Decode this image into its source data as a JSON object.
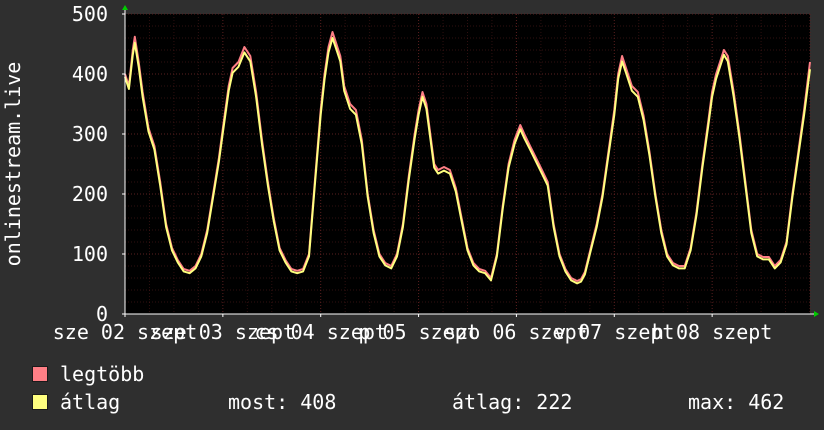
{
  "chart_data": {
    "type": "line",
    "ylabel": "onlinestream.live",
    "ylim": [
      0,
      500
    ],
    "yticks": [
      0,
      100,
      200,
      300,
      400,
      500
    ],
    "x_tick_labels": [
      "sze 02 szept",
      "sze 03 szept",
      "cs 04 szept",
      "p 05 szept",
      "szo 06 szept",
      "v 07 szept",
      "h 08 szept"
    ],
    "grid": true,
    "colors": {
      "max": "#ff7f86",
      "avg": "#ffff7f",
      "background": "#2f2f2f",
      "plot": "#000000",
      "grid": "#5a1f1f",
      "axis": "#ffffff",
      "arrow": "#00cc00"
    },
    "series": [
      {
        "name": "legtöbb",
        "key": "max",
        "points": [
          [
            0,
            400
          ],
          [
            0.04,
            380
          ],
          [
            0.08,
            440
          ],
          [
            0.1,
            462
          ],
          [
            0.14,
            420
          ],
          [
            0.18,
            370
          ],
          [
            0.24,
            310
          ],
          [
            0.3,
            280
          ],
          [
            0.36,
            220
          ],
          [
            0.42,
            150
          ],
          [
            0.48,
            110
          ],
          [
            0.54,
            90
          ],
          [
            0.6,
            75
          ],
          [
            0.66,
            72
          ],
          [
            0.72,
            80
          ],
          [
            0.78,
            100
          ],
          [
            0.84,
            140
          ],
          [
            0.9,
            200
          ],
          [
            0.96,
            260
          ],
          [
            1.0,
            310
          ],
          [
            1.06,
            380
          ],
          [
            1.1,
            410
          ],
          [
            1.16,
            420
          ],
          [
            1.22,
            445
          ],
          [
            1.28,
            430
          ],
          [
            1.34,
            370
          ],
          [
            1.4,
            290
          ],
          [
            1.46,
            220
          ],
          [
            1.52,
            160
          ],
          [
            1.58,
            110
          ],
          [
            1.64,
            90
          ],
          [
            1.7,
            75
          ],
          [
            1.76,
            72
          ],
          [
            1.82,
            75
          ],
          [
            1.88,
            100
          ],
          [
            1.94,
            220
          ],
          [
            2.0,
            340
          ],
          [
            2.04,
            400
          ],
          [
            2.08,
            445
          ],
          [
            2.12,
            470
          ],
          [
            2.16,
            450
          ],
          [
            2.2,
            430
          ],
          [
            2.24,
            380
          ],
          [
            2.3,
            350
          ],
          [
            2.36,
            340
          ],
          [
            2.42,
            290
          ],
          [
            2.48,
            200
          ],
          [
            2.54,
            140
          ],
          [
            2.6,
            100
          ],
          [
            2.66,
            85
          ],
          [
            2.72,
            80
          ],
          [
            2.78,
            100
          ],
          [
            2.84,
            150
          ],
          [
            2.9,
            230
          ],
          [
            2.96,
            300
          ],
          [
            3.0,
            340
          ],
          [
            3.04,
            370
          ],
          [
            3.08,
            350
          ],
          [
            3.12,
            300
          ],
          [
            3.16,
            250
          ],
          [
            3.2,
            240
          ],
          [
            3.26,
            245
          ],
          [
            3.32,
            240
          ],
          [
            3.38,
            210
          ],
          [
            3.44,
            160
          ],
          [
            3.5,
            110
          ],
          [
            3.56,
            85
          ],
          [
            3.62,
            75
          ],
          [
            3.68,
            72
          ],
          [
            3.74,
            60
          ],
          [
            3.8,
            100
          ],
          [
            3.86,
            180
          ],
          [
            3.92,
            250
          ],
          [
            3.98,
            290
          ],
          [
            4.04,
            315
          ],
          [
            4.08,
            300
          ],
          [
            4.14,
            280
          ],
          [
            4.2,
            260
          ],
          [
            4.26,
            240
          ],
          [
            4.32,
            220
          ],
          [
            4.38,
            150
          ],
          [
            4.44,
            100
          ],
          [
            4.5,
            75
          ],
          [
            4.56,
            60
          ],
          [
            4.62,
            55
          ],
          [
            4.66,
            58
          ],
          [
            4.7,
            70
          ],
          [
            4.76,
            110
          ],
          [
            4.82,
            150
          ],
          [
            4.88,
            200
          ],
          [
            4.94,
            270
          ],
          [
            5.0,
            340
          ],
          [
            5.04,
            400
          ],
          [
            5.08,
            430
          ],
          [
            5.12,
            410
          ],
          [
            5.18,
            380
          ],
          [
            5.24,
            370
          ],
          [
            5.3,
            330
          ],
          [
            5.36,
            270
          ],
          [
            5.42,
            200
          ],
          [
            5.48,
            140
          ],
          [
            5.54,
            100
          ],
          [
            5.6,
            85
          ],
          [
            5.66,
            80
          ],
          [
            5.72,
            80
          ],
          [
            5.78,
            110
          ],
          [
            5.84,
            170
          ],
          [
            5.9,
            250
          ],
          [
            5.96,
            320
          ],
          [
            6.0,
            370
          ],
          [
            6.04,
            400
          ],
          [
            6.08,
            420
          ],
          [
            6.12,
            440
          ],
          [
            6.16,
            430
          ],
          [
            6.22,
            370
          ],
          [
            6.28,
            300
          ],
          [
            6.34,
            220
          ],
          [
            6.4,
            140
          ],
          [
            6.46,
            100
          ],
          [
            6.52,
            95
          ],
          [
            6.58,
            95
          ],
          [
            6.64,
            80
          ],
          [
            6.7,
            90
          ],
          [
            6.76,
            120
          ],
          [
            6.82,
            200
          ],
          [
            6.88,
            270
          ],
          [
            6.94,
            340
          ],
          [
            7.0,
            420
          ]
        ]
      },
      {
        "name": "átlag",
        "key": "avg",
        "points": [
          [
            0,
            395
          ],
          [
            0.04,
            375
          ],
          [
            0.08,
            432
          ],
          [
            0.1,
            452
          ],
          [
            0.14,
            412
          ],
          [
            0.18,
            362
          ],
          [
            0.24,
            304
          ],
          [
            0.3,
            274
          ],
          [
            0.36,
            214
          ],
          [
            0.42,
            145
          ],
          [
            0.48,
            106
          ],
          [
            0.54,
            86
          ],
          [
            0.6,
            71
          ],
          [
            0.66,
            68
          ],
          [
            0.72,
            76
          ],
          [
            0.78,
            96
          ],
          [
            0.84,
            135
          ],
          [
            0.9,
            195
          ],
          [
            0.96,
            254
          ],
          [
            1.0,
            303
          ],
          [
            1.06,
            372
          ],
          [
            1.1,
            402
          ],
          [
            1.16,
            412
          ],
          [
            1.22,
            436
          ],
          [
            1.28,
            421
          ],
          [
            1.34,
            362
          ],
          [
            1.4,
            283
          ],
          [
            1.46,
            214
          ],
          [
            1.52,
            155
          ],
          [
            1.58,
            106
          ],
          [
            1.64,
            86
          ],
          [
            1.7,
            71
          ],
          [
            1.76,
            68
          ],
          [
            1.82,
            71
          ],
          [
            1.88,
            96
          ],
          [
            1.94,
            214
          ],
          [
            2.0,
            332
          ],
          [
            2.04,
            392
          ],
          [
            2.08,
            436
          ],
          [
            2.12,
            460
          ],
          [
            2.16,
            441
          ],
          [
            2.2,
            421
          ],
          [
            2.24,
            372
          ],
          [
            2.3,
            342
          ],
          [
            2.36,
            332
          ],
          [
            2.42,
            283
          ],
          [
            2.48,
            195
          ],
          [
            2.54,
            135
          ],
          [
            2.6,
            96
          ],
          [
            2.66,
            81
          ],
          [
            2.72,
            76
          ],
          [
            2.78,
            96
          ],
          [
            2.84,
            145
          ],
          [
            2.9,
            224
          ],
          [
            2.96,
            293
          ],
          [
            3.0,
            332
          ],
          [
            3.04,
            362
          ],
          [
            3.08,
            342
          ],
          [
            3.12,
            293
          ],
          [
            3.16,
            244
          ],
          [
            3.2,
            234
          ],
          [
            3.26,
            239
          ],
          [
            3.32,
            234
          ],
          [
            3.38,
            204
          ],
          [
            3.44,
            155
          ],
          [
            3.5,
            106
          ],
          [
            3.56,
            81
          ],
          [
            3.62,
            71
          ],
          [
            3.68,
            68
          ],
          [
            3.74,
            56
          ],
          [
            3.8,
            96
          ],
          [
            3.86,
            175
          ],
          [
            3.92,
            244
          ],
          [
            3.98,
            283
          ],
          [
            4.04,
            308
          ],
          [
            4.08,
            293
          ],
          [
            4.14,
            274
          ],
          [
            4.2,
            254
          ],
          [
            4.26,
            234
          ],
          [
            4.32,
            214
          ],
          [
            4.38,
            145
          ],
          [
            4.44,
            96
          ],
          [
            4.5,
            71
          ],
          [
            4.56,
            56
          ],
          [
            4.62,
            51
          ],
          [
            4.66,
            54
          ],
          [
            4.7,
            66
          ],
          [
            4.76,
            106
          ],
          [
            4.82,
            145
          ],
          [
            4.88,
            195
          ],
          [
            4.94,
            264
          ],
          [
            5.0,
            332
          ],
          [
            5.04,
            392
          ],
          [
            5.08,
            421
          ],
          [
            5.12,
            402
          ],
          [
            5.18,
            372
          ],
          [
            5.24,
            362
          ],
          [
            5.3,
            323
          ],
          [
            5.36,
            264
          ],
          [
            5.42,
            195
          ],
          [
            5.48,
            135
          ],
          [
            5.54,
            96
          ],
          [
            5.6,
            81
          ],
          [
            5.66,
            76
          ],
          [
            5.72,
            76
          ],
          [
            5.78,
            106
          ],
          [
            5.84,
            165
          ],
          [
            5.9,
            244
          ],
          [
            5.96,
            313
          ],
          [
            6.0,
            362
          ],
          [
            6.04,
            392
          ],
          [
            6.08,
            412
          ],
          [
            6.12,
            432
          ],
          [
            6.16,
            421
          ],
          [
            6.22,
            362
          ],
          [
            6.28,
            293
          ],
          [
            6.34,
            214
          ],
          [
            6.4,
            135
          ],
          [
            6.46,
            96
          ],
          [
            6.52,
            91
          ],
          [
            6.58,
            91
          ],
          [
            6.64,
            76
          ],
          [
            6.7,
            86
          ],
          [
            6.76,
            116
          ],
          [
            6.82,
            195
          ],
          [
            6.88,
            264
          ],
          [
            6.94,
            332
          ],
          [
            7.0,
            408
          ]
        ]
      }
    ]
  },
  "legend": [
    {
      "label": "legtöbb",
      "color": "#ff7f86"
    },
    {
      "label": "átlag",
      "color": "#ffff7f"
    }
  ],
  "stats": {
    "now": "most: 408",
    "avg": "átlag: 222",
    "max": "max: 462"
  }
}
